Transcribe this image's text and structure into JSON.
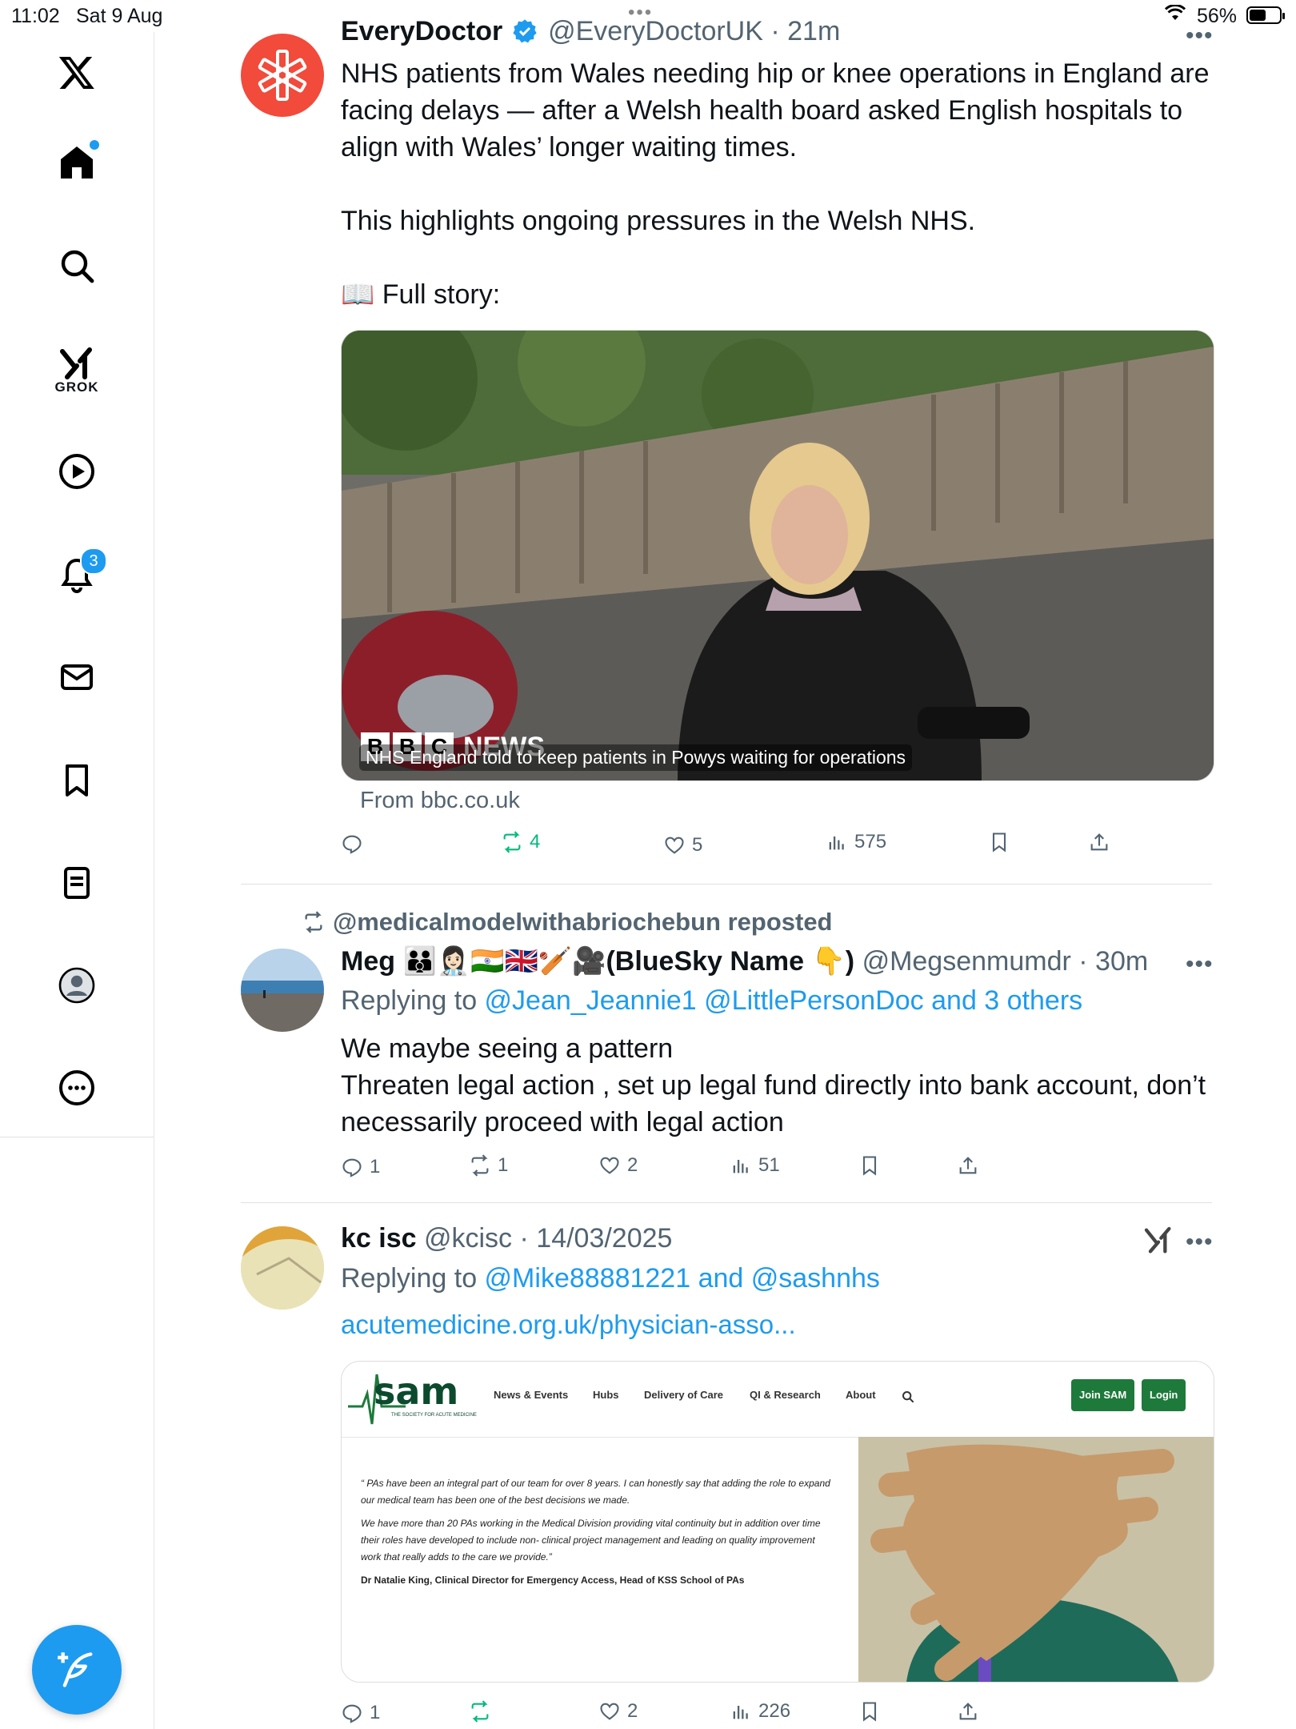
{
  "status_bar": {
    "time": "11:02",
    "date": "Sat 9 Aug",
    "battery": "56%",
    "battery_level": 0.56
  },
  "sidebar": {
    "notifications_count": "3",
    "grok_label": "GROK"
  },
  "tweets": [
    {
      "display_name": "EveryDoctor",
      "handle": "@EveryDoctorUK",
      "time": "21m",
      "text": "NHS patients from Wales needing hip or knee operations in England are facing delays — after a Welsh health board asked English hospitals to align with Wales’ longer waiting times.\n\nThis highlights ongoing pressures in the Welsh NHS.\n\n📖 Full story:",
      "card_caption": "NHS England told to keep patients in Powys waiting for operations",
      "card_source": "From bbc.co.uk",
      "card_brand": [
        "B",
        "B",
        "C"
      ],
      "card_brand_word": "NEWS",
      "actions": {
        "replies": "",
        "reposts": "4",
        "likes": "5",
        "views": "575"
      }
    },
    {
      "reposted_by": "@medicalmodelwithabriochebun reposted",
      "display_name": "Meg 👪👩🏻‍⚕️🇮🇳🇬🇧🏏🎥(BlueSky Name 👇)",
      "handle": "@Megsenmumdr",
      "time": "30m",
      "replying_prefix": "Replying to ",
      "replying_to": "@Jean_Jeannie1 @LittlePersonDoc and 3 others",
      "text": "We maybe seeing a pattern\nThreaten legal action , set up legal fund directly into bank account, don’t necessarily proceed with legal action",
      "actions": {
        "replies": "1",
        "reposts": "1",
        "likes": "2",
        "views": "51"
      }
    },
    {
      "display_name": "kc isc",
      "handle": "@kcisc",
      "time": "14/03/2025",
      "replying_prefix": "Replying to ",
      "replying_to": "@Mike88881221 and @sashnhs",
      "url": "acutemedicine.org.uk/physician-asso...",
      "sam": {
        "logo": "sam",
        "logo_sub": "THE SOCIETY FOR ACUTE MEDICINE",
        "menu": [
          "News & Events",
          "Hubs",
          "Delivery of Care",
          "QI & Research",
          "About"
        ],
        "join": "Join SAM",
        "login": "Login",
        "quote1": "“ PAs have been an integral part of our team for over 8 years. I can honestly say that adding the role to expand our medical team has been one of the best decisions we made.",
        "quote2": "We have more than 20 PAs working in the Medical Division providing vital continuity but in addition over time their roles have developed to include non- clinical project management and leading on quality improvement work that really adds to the care we provide.”",
        "signature": "Dr Natalie King, Clinical Director for Emergency Access, Head of KSS School of PAs"
      },
      "actions": {
        "replies": "1",
        "reposts": "",
        "likes": "2",
        "views": "226"
      }
    }
  ],
  "colors": {
    "accent": "#1d9bf0",
    "repost_active": "#00ba7c",
    "everydoctor_red": "#f24a3b"
  }
}
